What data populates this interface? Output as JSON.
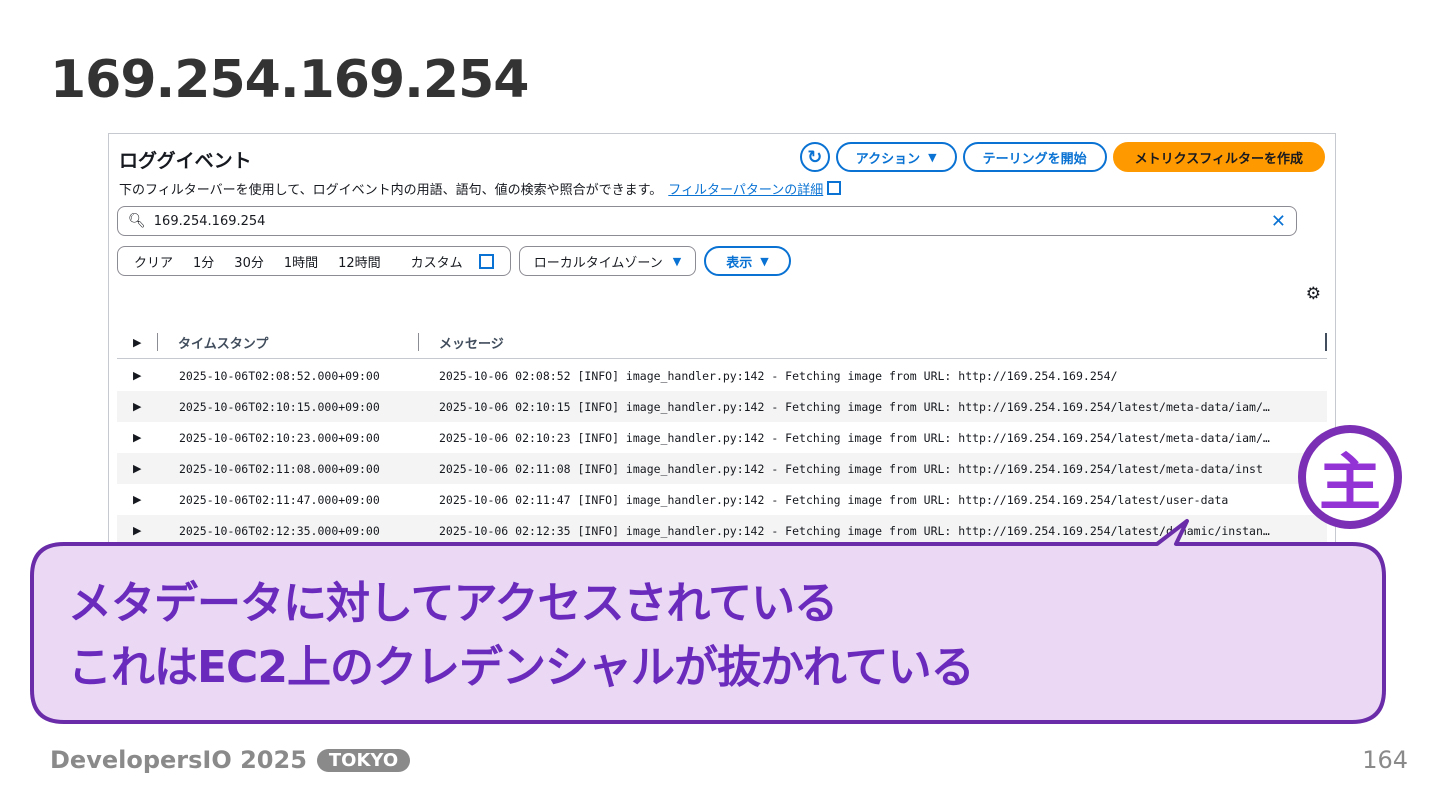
{
  "slide": {
    "title": "169.254.169.254",
    "page_number": "164",
    "brand": "DevelopersIO 2025",
    "brand_tag": "TOKYO"
  },
  "panel": {
    "title": "ロググイベント",
    "description": "下のフィルターバーを使用して、ログイベント内の用語、語句、値の検索や照合ができます。",
    "filter_link": "フィルターパターンの詳細",
    "refresh_icon": "refresh-icon",
    "actions_label": "アクション",
    "tailing_label": "テーリングを開始",
    "create_metric_label": "メトリクスフィルターを作成",
    "search_value": "169.254.169.254",
    "time_filters": [
      "クリア",
      "1分",
      "30分",
      "1時間",
      "12時間"
    ],
    "custom_label": "カスタム",
    "timezone_label": "ローカルタイムゾーン",
    "display_label": "表示",
    "columns": {
      "timestamp": "タイムスタンプ",
      "message": "メッセージ"
    },
    "rows": [
      {
        "timestamp": "2025-10-06T02:08:52.000+09:00",
        "message": "2025-10-06 02:08:52 [INFO] image_handler.py:142 - Fetching image from URL: http://169.254.169.254/"
      },
      {
        "timestamp": "2025-10-06T02:10:15.000+09:00",
        "message": "2025-10-06 02:10:15 [INFO] image_handler.py:142 - Fetching image from URL: http://169.254.169.254/latest/meta-data/iam/…"
      },
      {
        "timestamp": "2025-10-06T02:10:23.000+09:00",
        "message": "2025-10-06 02:10:23 [INFO] image_handler.py:142 - Fetching image from URL: http://169.254.169.254/latest/meta-data/iam/…"
      },
      {
        "timestamp": "2025-10-06T02:11:08.000+09:00",
        "message": "2025-10-06 02:11:08 [INFO] image_handler.py:142 - Fetching image from URL: http://169.254.169.254/latest/meta-data/inst"
      },
      {
        "timestamp": "2025-10-06T02:11:47.000+09:00",
        "message": "2025-10-06 02:11:47 [INFO] image_handler.py:142 - Fetching image from URL: http://169.254.169.254/latest/user-data"
      },
      {
        "timestamp": "2025-10-06T02:12:35.000+09:00",
        "message": "2025-10-06 02:12:35 [INFO] image_handler.py:142 - Fetching image from URL: http://169.254.169.254/latest/dynamic/instan…"
      }
    ]
  },
  "callout": {
    "line1": "メタデータに対してアクセスされている",
    "line2": "これはEC2上のクレデンシャルが抜かれている",
    "badge_char": "主"
  },
  "colors": {
    "accent": "#0972d3",
    "primary_button": "#ff9900",
    "callout_fill": "#ead8f5",
    "callout_border": "#6a2ca8",
    "callout_text": "#6a2bbd",
    "badge": "#7b2fb4"
  }
}
